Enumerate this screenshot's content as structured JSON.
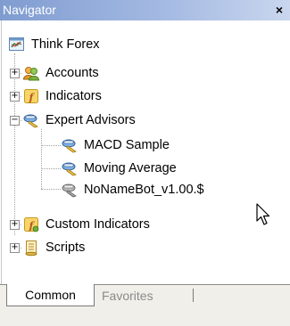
{
  "window": {
    "title": "Navigator",
    "close_label": "×"
  },
  "tree": {
    "root": {
      "label": "Think Forex",
      "icon": "terminal-icon"
    },
    "items": [
      {
        "label": "Accounts",
        "icon": "accounts-icon",
        "expander": "+"
      },
      {
        "label": "Indicators",
        "icon": "indicators-icon",
        "expander": "+"
      },
      {
        "label": "Expert Advisors",
        "icon": "expert-advisors-icon",
        "expander": "−"
      },
      {
        "label": "MACD Sample",
        "icon": "expert-icon"
      },
      {
        "label": "Moving Average",
        "icon": "expert-icon"
      },
      {
        "label": "NoNameBot_v1.00.$",
        "icon": "expert-disabled-icon"
      },
      {
        "label": "Custom Indicators",
        "icon": "custom-indicators-icon",
        "expander": "+"
      },
      {
        "label": "Scripts",
        "icon": "scripts-icon",
        "expander": "+"
      }
    ]
  },
  "tabs": [
    {
      "label": "Common"
    },
    {
      "label": "Favorites"
    }
  ]
}
